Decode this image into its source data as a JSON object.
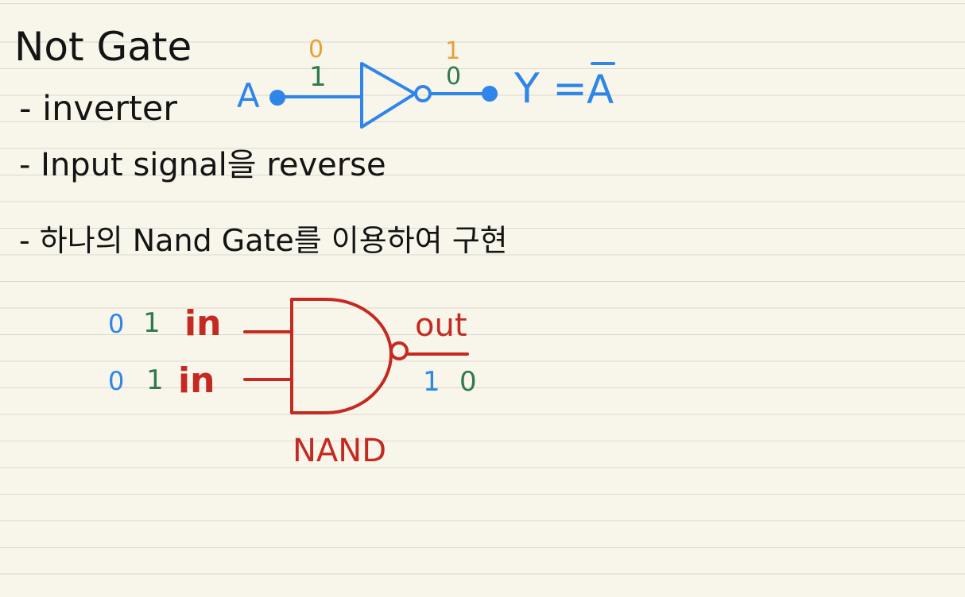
{
  "notes": {
    "title": "Not Gate",
    "bullet_1": "- inverter",
    "bullet_2": "- Input signal을 reverse",
    "bullet_3": "- 하나의 Nand Gate를 이용하여 구현"
  },
  "not_gate": {
    "input_label": "A",
    "input_value_top": "0",
    "input_value_wire": "1",
    "output_value_top": "1",
    "output_value_wire": "0",
    "output_expr_prefix": "Y =",
    "output_expr_var": "A"
  },
  "nand_gate": {
    "label": "NAND",
    "input_1": {
      "blue_value": "0",
      "green_value": "1",
      "label": "in"
    },
    "input_2": {
      "blue_value": "0",
      "green_value": "1",
      "label": "in"
    },
    "output_label": "out",
    "output_value_blue": "1",
    "output_value_green": "0"
  },
  "colors": {
    "black_ink": "#141414",
    "blue_ink": "#2e86e8",
    "red_ink": "#c42a22",
    "orange_ink": "#e6a137",
    "green_ink": "#2f7a4c",
    "paper": "#f8f5ea"
  }
}
